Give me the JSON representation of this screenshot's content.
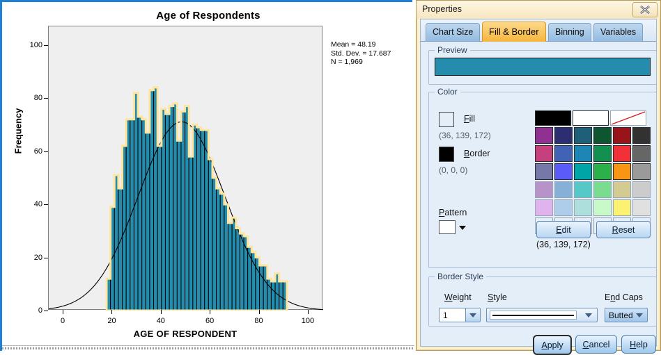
{
  "chart_panel": {
    "title": "Age of Respondents",
    "stats": "Mean = 48.19\nStd. Dev. = 17.687\nN = 1,969"
  },
  "chart_data": {
    "type": "bar",
    "title": "Age of Respondents",
    "xlabel": "AGE OF RESPONDENT",
    "ylabel": "Frequency",
    "xlim": [
      -6,
      106
    ],
    "ylim": [
      0,
      107
    ],
    "xticks": [
      0,
      20,
      40,
      60,
      80,
      100
    ],
    "yticks": [
      0,
      20,
      40,
      60,
      80,
      100
    ],
    "grid": false,
    "legend": null,
    "bin_width": 1.6,
    "bar_fill": "#248cac",
    "bar_border": "#000000",
    "selection_outline": "#ffe49b",
    "normal_curve": true,
    "mean": 48.19,
    "std_dev": 17.687,
    "n": 1969,
    "annotations": [
      "Mean = 48.19",
      "Std. Dev. = 17.687",
      "N = 1,969"
    ],
    "x": [
      18.4,
      20.0,
      21.6,
      23.2,
      24.8,
      26.4,
      28.0,
      29.6,
      31.2,
      32.8,
      34.4,
      36.0,
      37.6,
      39.2,
      40.8,
      42.4,
      44.0,
      45.6,
      47.2,
      48.8,
      50.4,
      52.0,
      53.6,
      55.2,
      56.8,
      58.4,
      60.0,
      61.6,
      63.2,
      64.8,
      66.4,
      68.0,
      69.6,
      71.2,
      72.8,
      74.4,
      76.0,
      77.6,
      79.2,
      80.8,
      82.4,
      84.0,
      85.6,
      87.2,
      88.8,
      90.4
    ],
    "values": [
      12,
      39,
      51,
      46,
      62,
      72,
      72,
      82,
      73,
      72,
      67,
      83,
      84,
      62,
      76,
      74,
      77,
      78,
      64,
      75,
      77,
      58,
      70,
      69,
      68,
      68,
      57,
      50,
      46,
      44,
      40,
      33,
      35,
      31,
      29,
      28,
      24,
      22,
      20,
      17,
      17,
      12,
      11,
      14,
      11,
      11
    ]
  },
  "dialog": {
    "title": "Properties",
    "close_label": "x",
    "tabs": [
      {
        "label": "Chart Size",
        "active": false
      },
      {
        "label": "Fill & Border",
        "active": true
      },
      {
        "label": "Binning",
        "active": false
      },
      {
        "label": "Variables",
        "active": false
      }
    ],
    "preview": {
      "group_title": "Preview",
      "swatch_color": "#248cac"
    },
    "color": {
      "group_title": "Color",
      "fill_label": "Fill",
      "fill_rgb": "(36, 139, 172)",
      "fill_color": "#248cac",
      "border_label": "Border",
      "border_rgb": "(0, 0, 0)",
      "border_color": "#000000",
      "pattern_label": "Pattern",
      "pattern_value": "#ffffff",
      "edit_label": "Edit",
      "reset_label": "Reset",
      "selected_rgb": "(36, 139, 172)",
      "palette_rows": [
        [
          "#000000",
          "#ffffff",
          "none-diagonal"
        ],
        [
          "#8e3191",
          "#2d2d72",
          "#1f5f77",
          "#0d5630",
          "#981418",
          "#323232"
        ],
        [
          "#c5417e",
          "#4263b4",
          "#1e86b4",
          "#12904f",
          "#f23038",
          "#666666"
        ],
        [
          "#7678a8",
          "#5a5bf8",
          "#00a5a8",
          "#2bb04a",
          "#f89512",
          "#9a9a9a"
        ],
        [
          "#b793c9",
          "#86b0d8",
          "#57c8c8",
          "#79dc8e",
          "#d4cb92",
          "#cccccc"
        ],
        [
          "#e0b3ee",
          "#aecdea",
          "#ade0dd",
          "#c7f9c9",
          "#fbf271",
          "#e0e0e0"
        ],
        [
          "#e4eefb",
          "#e4eefb",
          "#e4eefb",
          "#e4eefb",
          "#e4eefb",
          "#e4eefb"
        ]
      ]
    },
    "border_style": {
      "group_title": "Border Style",
      "weight_label": "Weight",
      "weight_value": "1",
      "style_label": "Style",
      "style_value": "solid-line",
      "endcaps_label": "End Caps",
      "endcaps_value": "Butted"
    },
    "buttons": {
      "apply": "Apply",
      "cancel": "Cancel",
      "help": "Help"
    }
  }
}
